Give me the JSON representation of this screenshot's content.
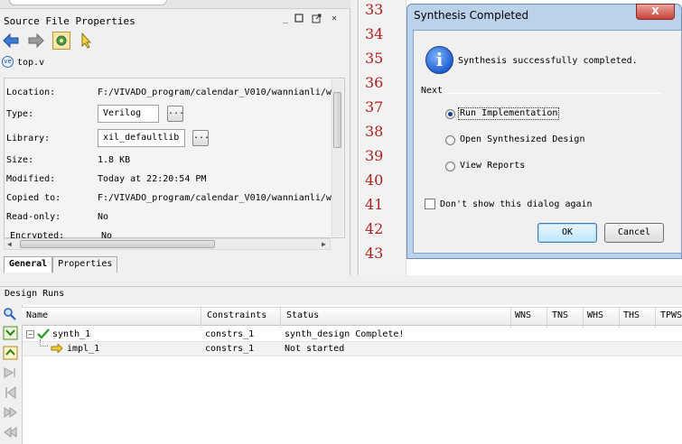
{
  "source_props": {
    "title": "Source File Properties",
    "file_name": "top.v",
    "file_icon_text": "ve",
    "fields": [
      {
        "label": "Location:",
        "value": "F:/VIVADO_program/calendar_V010/wannianli/w"
      },
      {
        "label": "Type:",
        "value": "Verilog"
      },
      {
        "label": "Library:",
        "value": "xil_defaultlib"
      },
      {
        "label": "Size:",
        "value": "1.8 KB"
      },
      {
        "label": "Modified:",
        "value": "Today at 22:20:54 PM"
      },
      {
        "label": "Copied to:",
        "value": "F:/VIVADO_program/calendar_V010/wannianli/w"
      },
      {
        "label": "Read-only:",
        "value": "No"
      },
      {
        "label": "Encrypted:",
        "value": "No"
      }
    ],
    "browse_label": "...",
    "tabs": [
      "General",
      "Properties"
    ]
  },
  "editor": {
    "line_numbers": [
      "33",
      "34",
      "35",
      "36",
      "37",
      "38",
      "39",
      "40",
      "41",
      "42",
      "43"
    ]
  },
  "dialog": {
    "title": "Synthesis Completed",
    "message": "Synthesis successfully completed.",
    "next_label": "Next",
    "options": [
      "Run Implementation",
      "Open Synthesized Design",
      "View Reports"
    ],
    "selected_option": "Run Implementation",
    "dont_show_label": "Don't show this dialog again",
    "ok_label": "OK",
    "cancel_label": "Cancel",
    "close_label": "X"
  },
  "design_runs": {
    "title": "Design Runs",
    "columns": [
      "Name",
      "Constraints",
      "Status",
      "WNS",
      "TNS",
      "WHS",
      "THS",
      "TPWS"
    ],
    "rows": [
      {
        "name": "synth_1",
        "constraints": "constrs_1",
        "status": "synth_design Complete!"
      },
      {
        "name": "impl_1",
        "constraints": "constrs_1",
        "status": "Not started"
      }
    ]
  },
  "colors": {
    "line_number": "#b02020",
    "dialog_frame": "#bcd1ea",
    "ok_highlight": "#bee6fd",
    "check_green": "#2e9e2e"
  }
}
